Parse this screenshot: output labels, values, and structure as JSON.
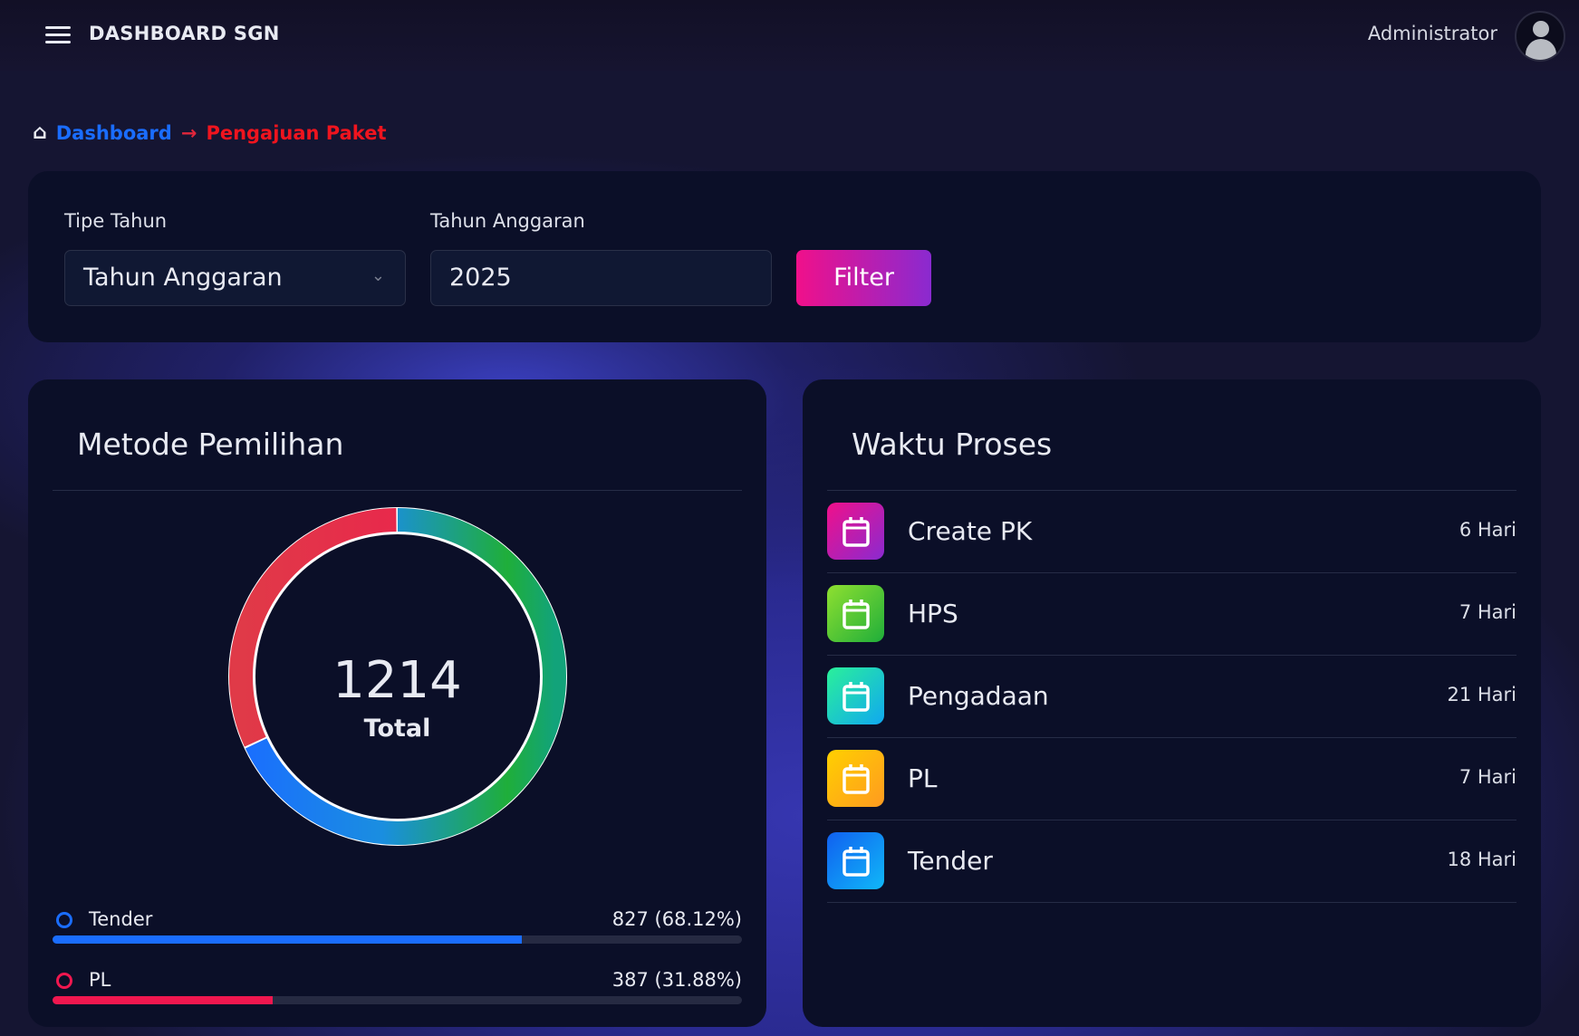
{
  "header": {
    "title": "DASHBOARD SGN",
    "user": "Administrator"
  },
  "breadcrumb": {
    "home": "Dashboard",
    "current": "Pengajuan Paket"
  },
  "filter": {
    "tipe_label": "Tipe Tahun",
    "tipe_value": "Tahun Anggaran",
    "tahun_label": "Tahun Anggaran",
    "tahun_value": "2025",
    "button": "Filter"
  },
  "metode": {
    "title": "Metode Pemilihan",
    "total": "1214",
    "total_label": "Total",
    "items": [
      {
        "name": "Tender",
        "value": "827 (68.12%)",
        "percent": 68.12,
        "color": "#1a6dff"
      },
      {
        "name": "PL",
        "value": "387 (31.88%)",
        "percent": 31.88,
        "color": "#f0174f"
      }
    ]
  },
  "waktu": {
    "title": "Waktu Proses",
    "items": [
      {
        "name": "Create PK",
        "value": "6 Hari",
        "colors": [
          "#f0108a",
          "#8a2ad0"
        ]
      },
      {
        "name": "HPS",
        "value": "7 Hari",
        "colors": [
          "#8fe030",
          "#1fae3a"
        ]
      },
      {
        "name": "Pengadaan",
        "value": "21 Hari",
        "colors": [
          "#2af09a",
          "#10a8f0"
        ]
      },
      {
        "name": "PL",
        "value": "7 Hari",
        "colors": [
          "#ffd000",
          "#ff9a20"
        ]
      },
      {
        "name": "Tender",
        "value": "18 Hari",
        "colors": [
          "#1060f0",
          "#10b8f8"
        ]
      }
    ]
  }
}
